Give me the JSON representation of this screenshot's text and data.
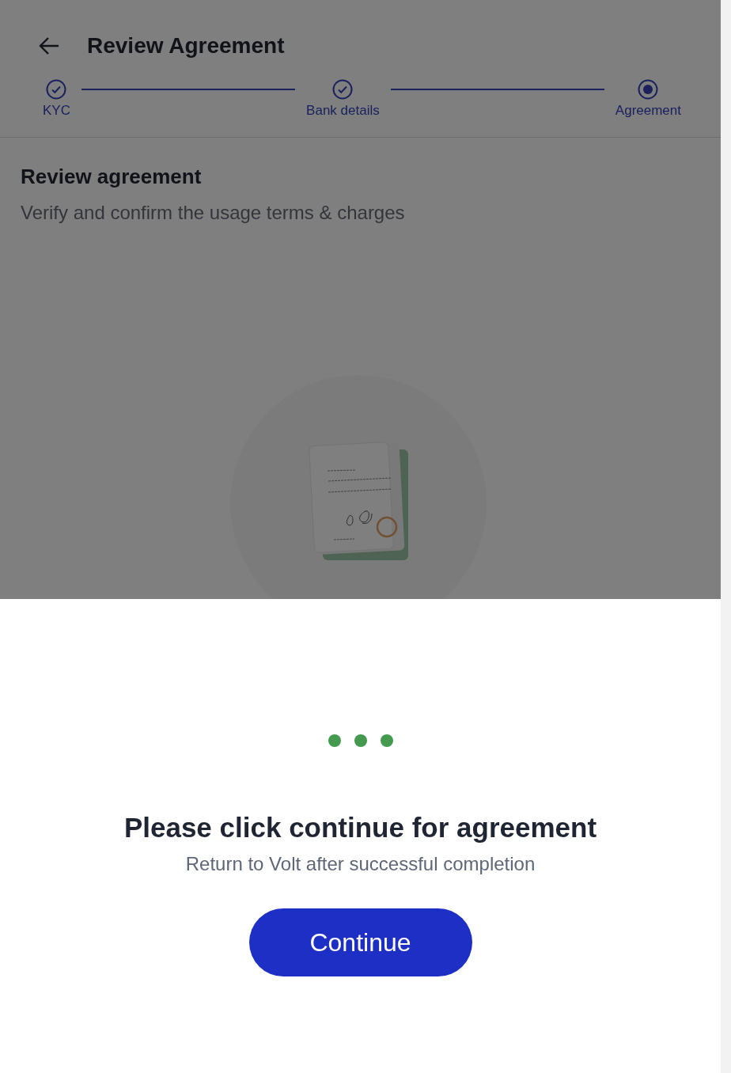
{
  "header": {
    "title": "Review Agreement"
  },
  "steps": [
    {
      "label": "KYC",
      "kind": "completed"
    },
    {
      "label": "Bank details",
      "kind": "completed"
    },
    {
      "label": "Agreement",
      "kind": "current"
    }
  ],
  "section": {
    "title": "Review agreement",
    "subtitle": "Verify and confirm the usage terms & charges"
  },
  "sheet": {
    "title": "Please click continue for agreement",
    "subtitle": "Return to Volt after successful completion",
    "button": "Continue"
  }
}
